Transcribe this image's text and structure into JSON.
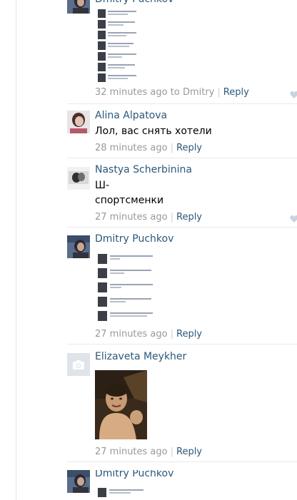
{
  "comments": [
    {
      "author": "Dmitry Puchkov",
      "time": "32 minutes ago",
      "reply_to_prefix": "to",
      "reply_to": "Dmitry",
      "reply_label": "Reply",
      "has_like": true
    },
    {
      "author": "Alina Alpatova",
      "text_lines": [
        "Лол, вас снять хотели"
      ],
      "time": "28 minutes ago",
      "reply_label": "Reply",
      "has_like": false
    },
    {
      "author": "Nastya Scherbinina",
      "text_lines": [
        "Ш-",
        "спортсменки"
      ],
      "time": "27 minutes ago",
      "reply_label": "Reply",
      "has_like": true
    },
    {
      "author": "Dmitry Puchkov",
      "time": "27 minutes ago",
      "reply_label": "Reply",
      "has_like": false
    },
    {
      "author": "Elizaveta Meykher",
      "time": "27 minutes ago",
      "reply_label": "Reply",
      "has_like": false
    },
    {
      "author": "Dmitry Puchkov"
    }
  ],
  "colors": {
    "link": "#2b587a",
    "meta": "#999999",
    "divider": "#e7eaed",
    "like": "#c9d3de"
  },
  "icons": {
    "like": "heart-icon",
    "no_avatar": "camera-icon"
  }
}
